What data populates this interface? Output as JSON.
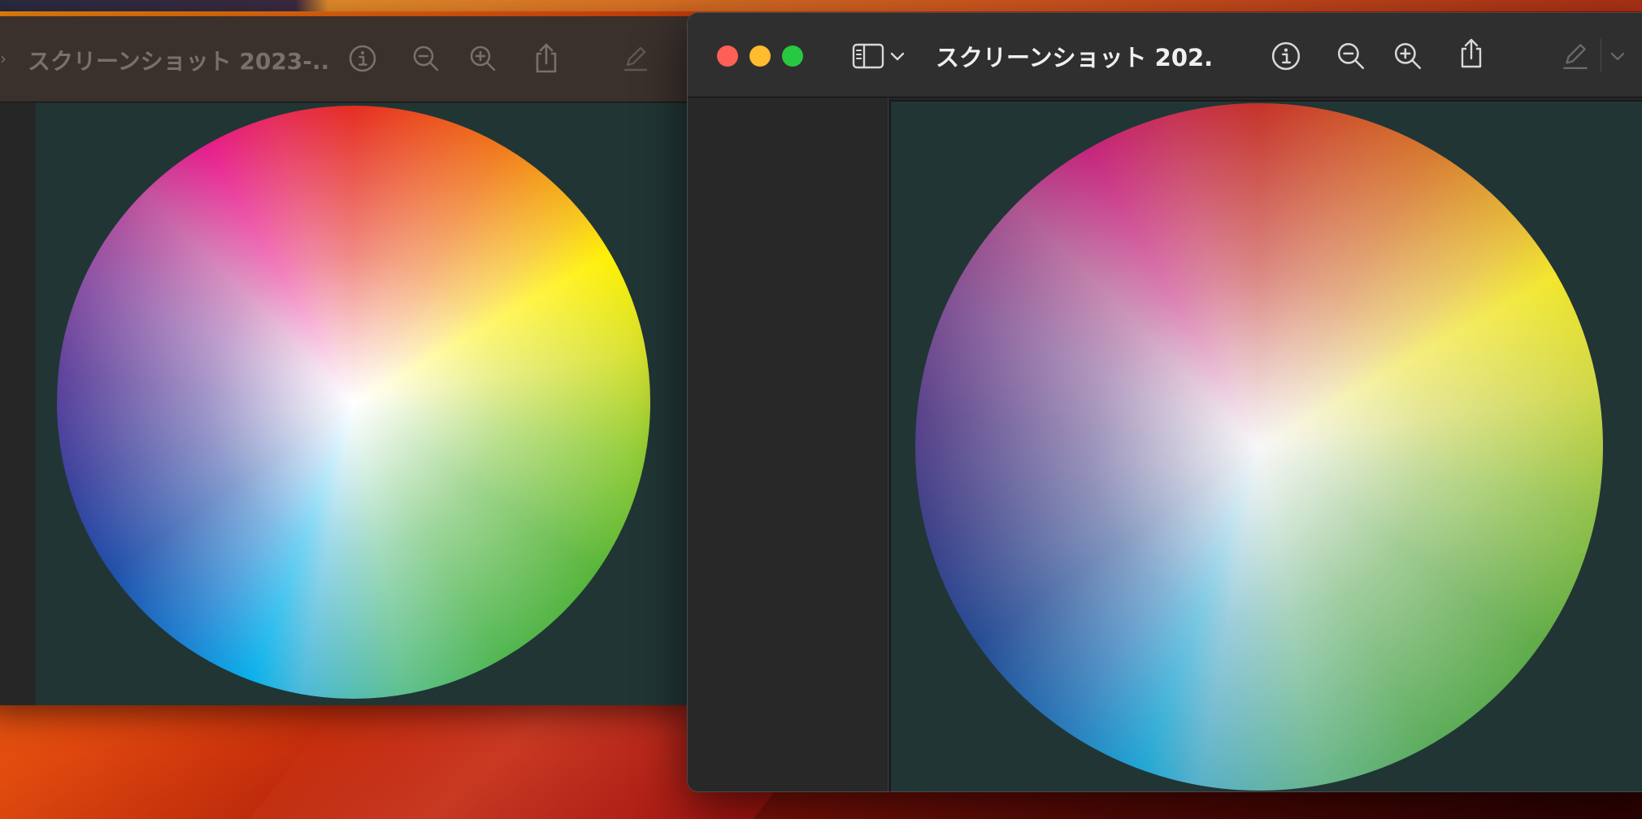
{
  "back_window": {
    "title": "スクリーンショット 2023-...",
    "toolbar": {
      "info_icon": "info-circle-icon",
      "zoom_out_icon": "magnifier-minus-icon",
      "zoom_in_icon": "magnifier-plus-icon",
      "share_icon": "share-icon",
      "markup_icon": "pencil-markup-icon"
    }
  },
  "front_window": {
    "title": "スクリーンショット 202...",
    "traffic_lights": {
      "close": "#fe5f57",
      "minimize": "#febc2e",
      "maximize": "#28c840"
    },
    "toolbar": {
      "sidebar_icon": "sidebar-toggle-icon",
      "sidebar_chevron": "chevron-down-icon",
      "info_icon": "info-circle-icon",
      "zoom_out_icon": "magnifier-minus-icon",
      "zoom_in_icon": "magnifier-plus-icon",
      "share_icon": "share-icon",
      "markup_icon": "pencil-markup-icon",
      "markup_chevron": "chevron-down-icon"
    },
    "document": {
      "content": "color-wheel-image",
      "background_color": "#213535"
    }
  },
  "colors": {
    "window_bg": "#262626",
    "front_toolbar": "#2f2f2f",
    "back_toolbar": "#3a302c"
  }
}
